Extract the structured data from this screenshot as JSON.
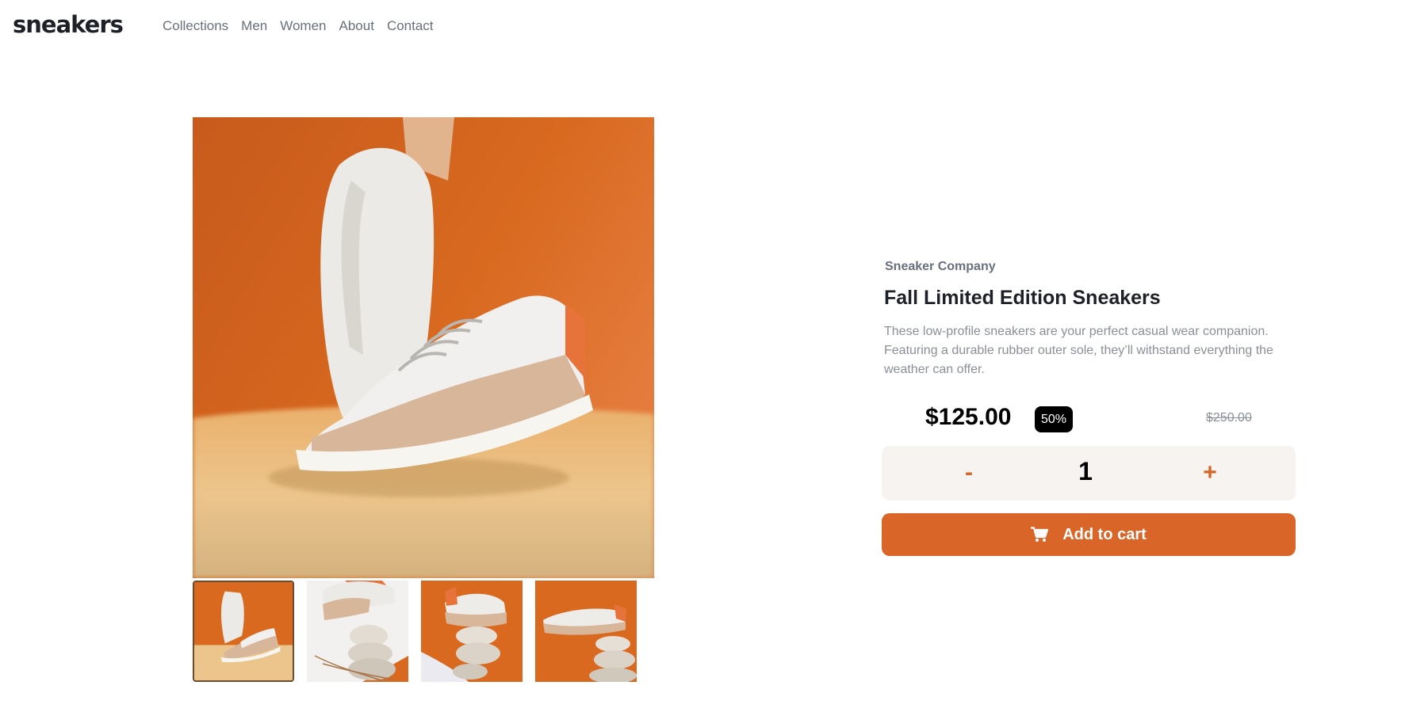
{
  "header": {
    "logo": "sneakers",
    "nav": [
      "Collections",
      "Men",
      "Women",
      "About",
      "Contact"
    ]
  },
  "gallery": {
    "thumbnail_count": 4,
    "active_thumbnail": 1
  },
  "product": {
    "company": "Sneaker Company",
    "title": "Fall Limited Edition Sneakers",
    "description": "These low-profile sneakers are your perfect casual wear companion. Featuring a durable rubber outer sole, they’ll withstand everything the weather can offer.",
    "price": "$125.00",
    "discount": "50%",
    "original_price": "$250.00"
  },
  "quantity": {
    "minus_label": "-",
    "value": "1",
    "plus_label": "+"
  },
  "cart": {
    "icon": "cart-icon",
    "button_label": "Add to cart"
  },
  "colors": {
    "accent": "#d96628",
    "quantity_bg": "#f6f3f1",
    "badge_bg": "#000000"
  }
}
